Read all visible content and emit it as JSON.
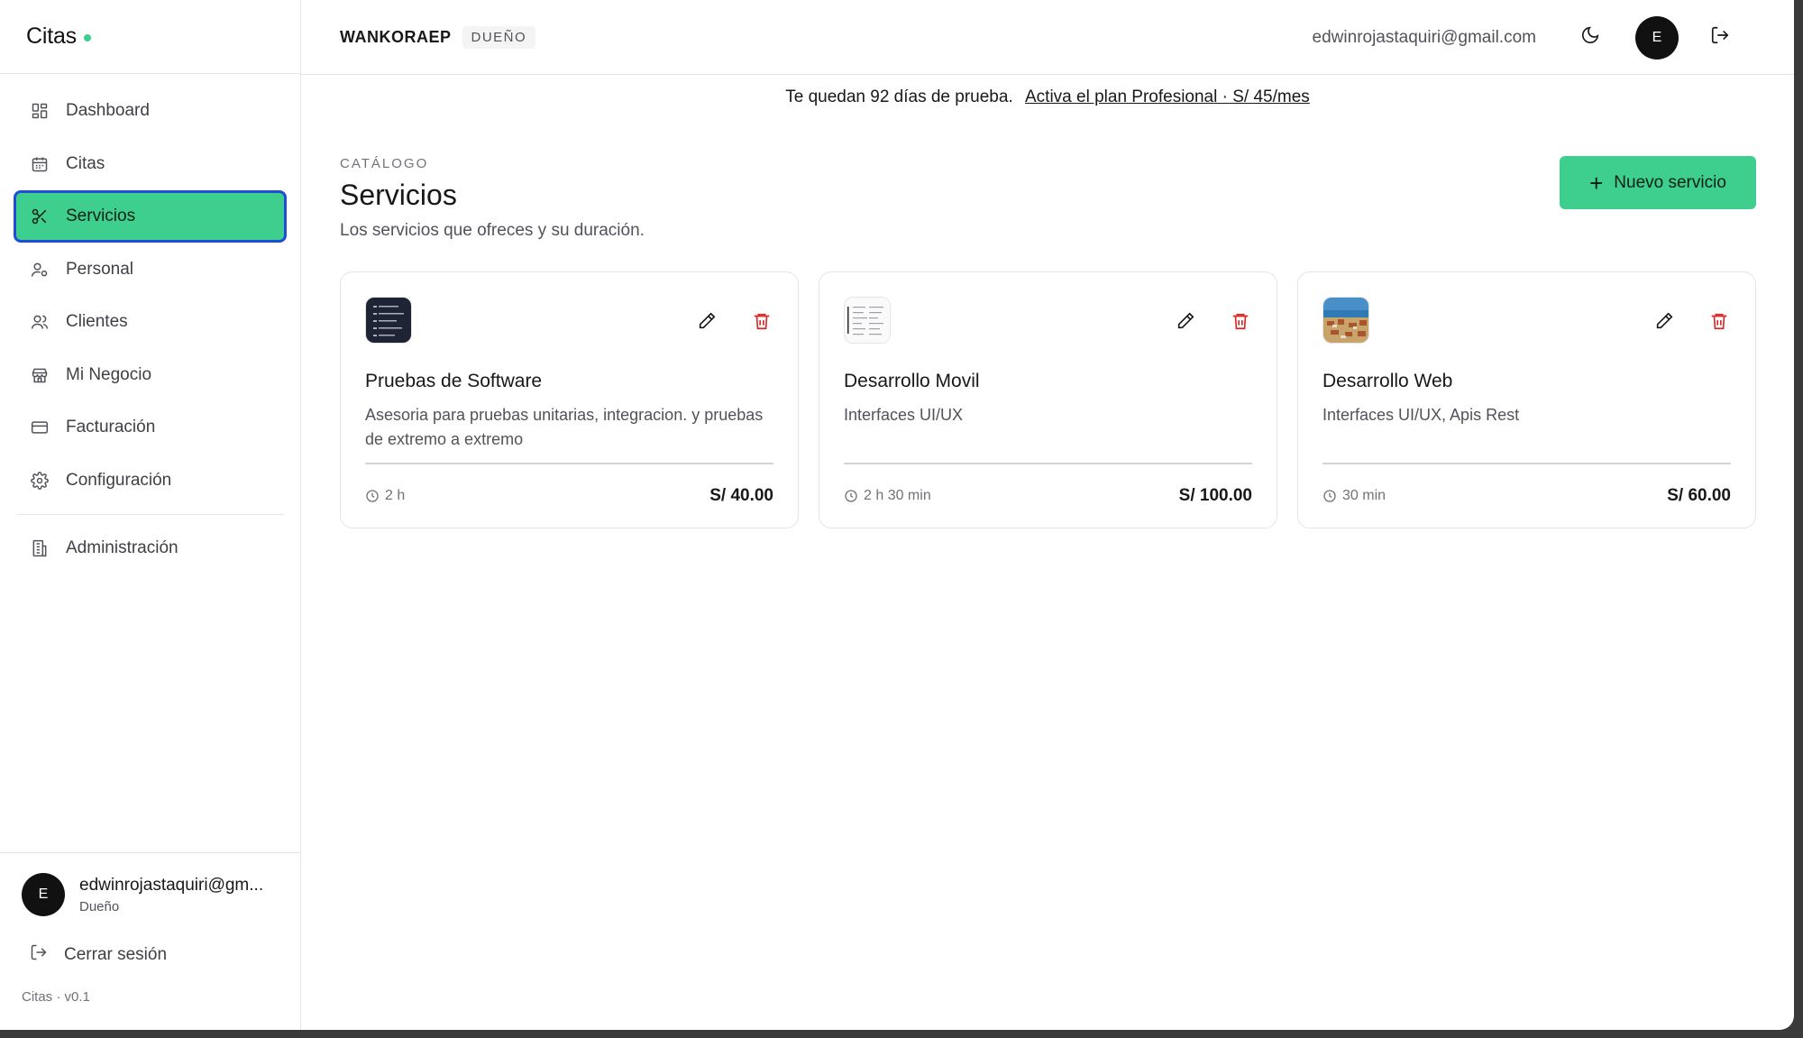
{
  "brand": {
    "name": "Citas",
    "dot_color": "#3ecf8e"
  },
  "sidebar": {
    "items": [
      {
        "label": "Dashboard",
        "icon": "dashboard-icon"
      },
      {
        "label": "Citas",
        "icon": "calendar-icon"
      },
      {
        "label": "Servicios",
        "icon": "scissors-icon",
        "active": true
      },
      {
        "label": "Personal",
        "icon": "user-cog-icon"
      },
      {
        "label": "Clientes",
        "icon": "users-icon"
      },
      {
        "label": "Mi Negocio",
        "icon": "store-icon"
      },
      {
        "label": "Facturación",
        "icon": "credit-card-icon"
      },
      {
        "label": "Configuración",
        "icon": "gear-icon"
      }
    ],
    "admin": {
      "label": "Administración",
      "icon": "building-icon"
    },
    "user": {
      "initial": "E",
      "email": "edwinrojastaquiri@gm...",
      "role": "Dueño"
    },
    "logout_label": "Cerrar sesión",
    "version": "Citas · v0.1"
  },
  "topbar": {
    "org_name": "WANKORAEP",
    "org_badge": "DUEÑO",
    "email": "edwinrojastaquiri@gmail.com",
    "avatar_initial": "E"
  },
  "trial": {
    "text": "Te quedan 92 días de prueba.",
    "link": "Activa el plan Profesional · S/ 45/mes"
  },
  "page": {
    "eyebrow": "CATÁLOGO",
    "title": "Servicios",
    "subtitle": "Los servicios que ofreces y su duración.",
    "new_button": "Nuevo servicio"
  },
  "services": [
    {
      "name": "Pruebas de Software",
      "description": "Asesoria para pruebas unitarias, integracion. y pruebas de extremo a extremo",
      "duration": "2 h",
      "price": "S/ 40.00",
      "thumb": "dark"
    },
    {
      "name": "Desarrollo Movil",
      "description": "Interfaces UI/UX",
      "duration": "2 h 30 min",
      "price": "S/ 100.00",
      "thumb": "doc"
    },
    {
      "name": "Desarrollo Web",
      "description": "Interfaces UI/UX, Apis Rest",
      "duration": "30 min",
      "price": "S/ 60.00",
      "thumb": "landscape"
    }
  ],
  "colors": {
    "accent": "#3ecf8e",
    "focus": "#1d4ed8",
    "danger": "#dc2626"
  }
}
